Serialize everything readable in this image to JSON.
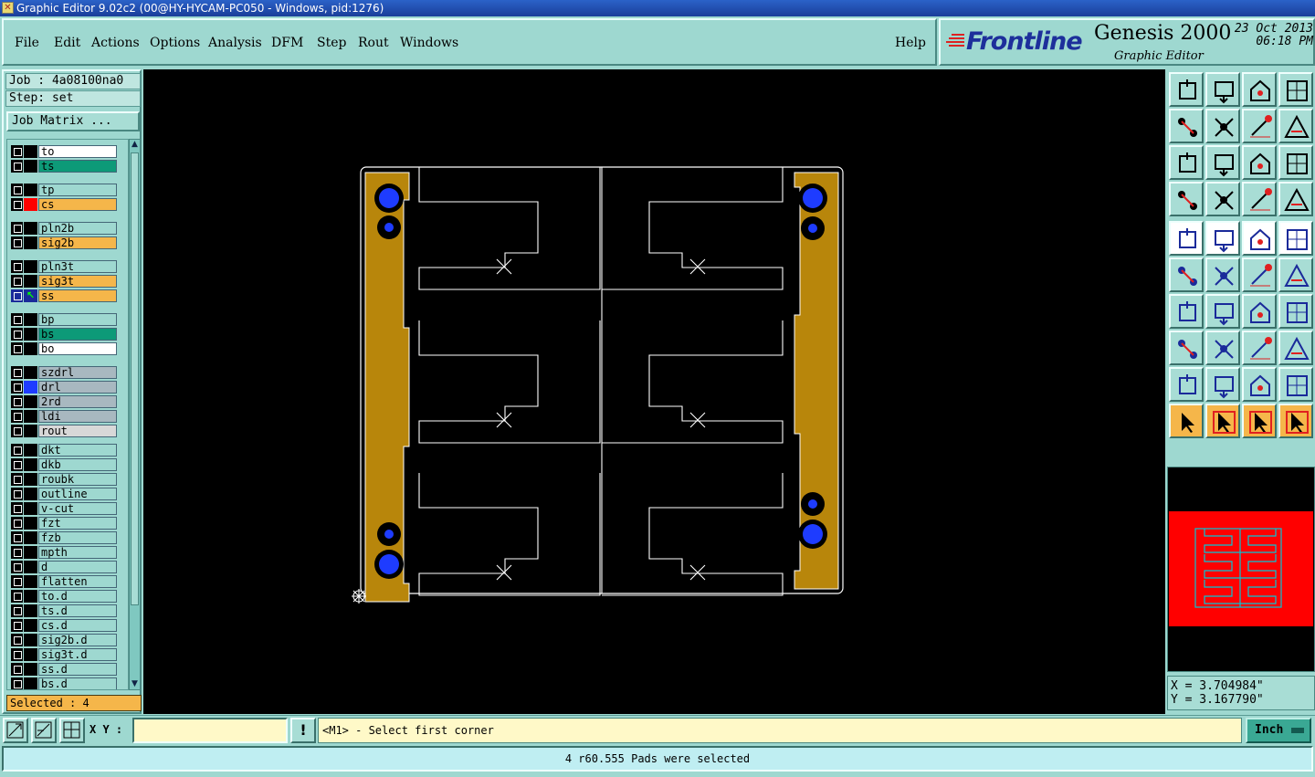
{
  "window": {
    "title": "Graphic Editor 9.02c2 (00@HY-HYCAM-PC050 - Windows, pid:1276)"
  },
  "menu": {
    "file": "File",
    "edit": "Edit",
    "actions": "Actions",
    "options": "Options",
    "analysis": "Analysis",
    "dfm": "DFM",
    "step": "Step",
    "rout": "Rout",
    "windows": "Windows",
    "help": "Help"
  },
  "brand": {
    "logo": "Frontline",
    "product": "Genesis 2000",
    "subtitle": "Graphic Editor",
    "date": "23 Oct 2013",
    "time": "06:18 PM"
  },
  "job": {
    "job_line": "Job : 4a08100na0",
    "step_line": "Step: set",
    "matrix_button": "Job Matrix ..."
  },
  "layers": [
    {
      "name": "to",
      "color": "#ffffff"
    },
    {
      "name": "ts",
      "color": "#0d9a78"
    },
    {
      "name": "tp",
      "color": "#9ed8d0"
    },
    {
      "name": "cs",
      "color": "#f5b64a",
      "swatch": "#ff0000"
    },
    {
      "name": "pln2b",
      "color": "#9ed8d0"
    },
    {
      "name": "sig2b",
      "color": "#f5b64a"
    },
    {
      "name": "pln3t",
      "color": "#9ed8d0"
    },
    {
      "name": "sig3t",
      "color": "#f5b64a"
    },
    {
      "name": "ss",
      "color": "#f5b64a",
      "work": true
    },
    {
      "name": "bp",
      "color": "#9ed8d0"
    },
    {
      "name": "bs",
      "color": "#0d9a78"
    },
    {
      "name": "bo",
      "color": "#ffffff"
    },
    {
      "name": "szdrl",
      "color": "#a8b8c0"
    },
    {
      "name": "drl",
      "color": "#a8b8c0",
      "swatch": "#1e3cff"
    },
    {
      "name": "2rd",
      "color": "#a8b8c0"
    },
    {
      "name": "ldi",
      "color": "#a8b8c0"
    },
    {
      "name": "rout",
      "color": "#d8d8d8"
    },
    {
      "name": "dkt",
      "color": "#9ed8d0"
    },
    {
      "name": "dkb",
      "color": "#9ed8d0"
    },
    {
      "name": "roubk",
      "color": "#9ed8d0"
    },
    {
      "name": "outline",
      "color": "#9ed8d0"
    },
    {
      "name": "v-cut",
      "color": "#9ed8d0"
    },
    {
      "name": "fzt",
      "color": "#9ed8d0"
    },
    {
      "name": "fzb",
      "color": "#9ed8d0"
    },
    {
      "name": "mpth",
      "color": "#9ed8d0"
    },
    {
      "name": "d",
      "color": "#9ed8d0"
    },
    {
      "name": "flatten",
      "color": "#9ed8d0"
    },
    {
      "name": "to.d",
      "color": "#9ed8d0"
    },
    {
      "name": "ts.d",
      "color": "#9ed8d0"
    },
    {
      "name": "cs.d",
      "color": "#9ed8d0"
    },
    {
      "name": "sig2b.d",
      "color": "#9ed8d0"
    },
    {
      "name": "sig3t.d",
      "color": "#9ed8d0"
    },
    {
      "name": "ss.d",
      "color": "#9ed8d0"
    },
    {
      "name": "bs.d",
      "color": "#9ed8d0"
    }
  ],
  "selected": "Selected : 4",
  "coords": {
    "x": "X = 3.704984\"",
    "y": "Y = 3.167790\""
  },
  "bottom": {
    "xy_label": "X Y :",
    "xy_value": "",
    "prompt": "<M1> - Select first corner",
    "unit": "Inch"
  },
  "status": "4 r60.555 Pads were selected",
  "colors": {
    "accent": "#9ed8d0",
    "board": "#b8860b",
    "pad": "#1e3cff",
    "preview_bg": "#ff0000",
    "preview_line": "#00c8d8"
  }
}
